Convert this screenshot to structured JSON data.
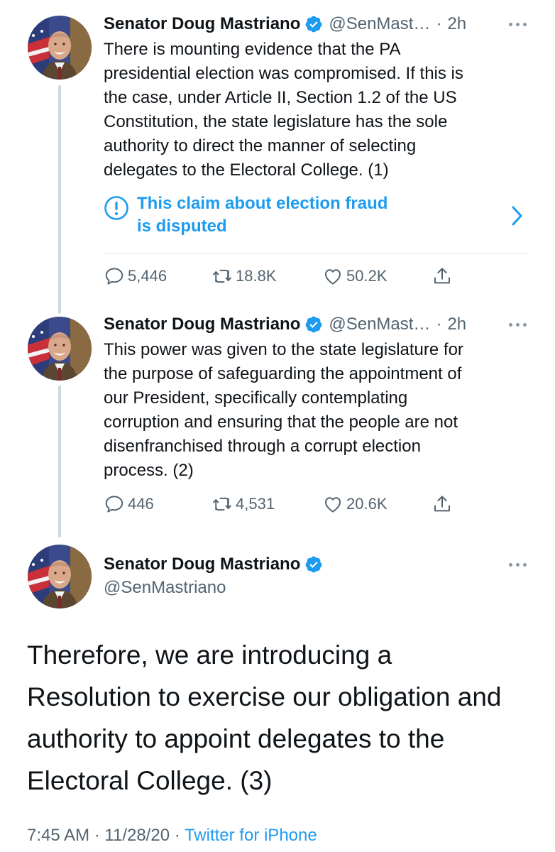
{
  "author": {
    "name": "Senator Doug Mastriano",
    "handle_truncated": "@SenMast…",
    "handle_full": "@SenMastriano"
  },
  "tweets": [
    {
      "time": "2h",
      "text": "There is mounting evidence that the PA\npresidential election was compromised.  If this is\nthe case, under Article II, Section 1.2 of the US\nConstitution, the state legislature has the sole\nauthority to direct the manner of selecting\ndelegates to the Electoral College. (1)",
      "notice": "This claim about election fraud\nis disputed",
      "replies": "5,446",
      "retweets": "18.8K",
      "likes": "50.2K"
    },
    {
      "time": "2h",
      "text": "This power was given to the state legislature for\nthe purpose of safeguarding the appointment of\nour President, specifically contemplating\ncorruption and ensuring that the people are not\ndisenfranchised through a corrupt election\nprocess. (2)",
      "replies": "446",
      "retweets": "4,531",
      "likes": "20.6K"
    }
  ],
  "main_tweet": {
    "text": "Therefore, we are introducing a\nResolution to exercise our obligation and\nauthority to appoint delegates to the\nElectoral College. (3)",
    "time": "7:45 AM",
    "date": "11/28/20",
    "source": "Twitter for iPhone"
  },
  "separator": "·",
  "icons": {
    "verified": "verified-badge-icon",
    "more": "more-options-icon",
    "notice": "info-circle-icon",
    "chevron": "chevron-right-icon",
    "reply": "reply-icon",
    "retweet": "retweet-icon",
    "like": "heart-icon",
    "share": "share-icon"
  },
  "colors": {
    "accent": "#1d9bf0",
    "text": "#0f1419",
    "secondary": "#536471",
    "thread_line": "#cfd9de"
  }
}
